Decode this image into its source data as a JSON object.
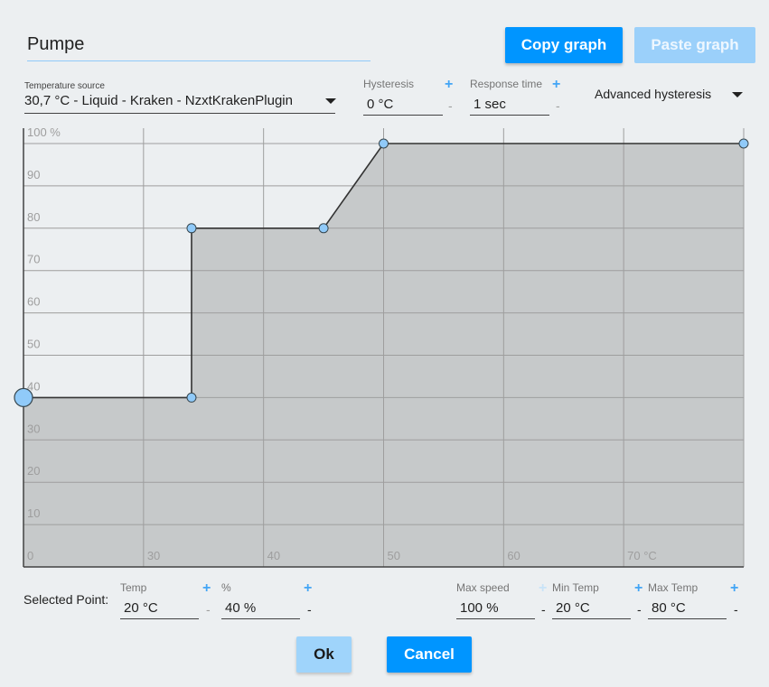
{
  "profile": {
    "name": "Pumpe"
  },
  "header": {
    "copy_label": "Copy graph",
    "paste_label": "Paste graph"
  },
  "source": {
    "label": "Temperature source",
    "value": "30,7 °C - Liquid - Kraken - NzxtKrakenPlugin"
  },
  "hysteresis": {
    "label": "Hysteresis",
    "value": "0 °C",
    "plus": "+",
    "minus": "-"
  },
  "response_time": {
    "label": "Response time",
    "value": "1 sec",
    "plus": "+",
    "minus": "-"
  },
  "advanced": {
    "label": "Advanced hysteresis"
  },
  "chart_data": {
    "type": "area",
    "x": [
      20,
      34,
      45,
      50,
      80
    ],
    "y": [
      40,
      40,
      80,
      80,
      100,
      100
    ],
    "points": [
      {
        "temp": 20,
        "percent": 40
      },
      {
        "temp": 34,
        "percent": 40
      },
      {
        "temp": 34,
        "percent": 80
      },
      {
        "temp": 45,
        "percent": 80
      },
      {
        "temp": 50,
        "percent": 100
      },
      {
        "temp": 80,
        "percent": 100
      }
    ],
    "xlim": [
      20,
      80
    ],
    "ylim": [
      0,
      100
    ],
    "x_ticks": [
      "0",
      "30",
      "40",
      "50",
      "60",
      "70 °C"
    ],
    "y_ticks": [
      "",
      "10",
      "20",
      "30",
      "40",
      "50",
      "60",
      "70",
      "80",
      "90",
      "100 %"
    ],
    "grid": true,
    "selected_index": 0,
    "colors": {
      "fill": "#c6c9ca",
      "line": "#333333",
      "point": "#90caf9",
      "grid": "#9e9e9e"
    }
  },
  "selected_point": {
    "label": "Selected Point:",
    "temp_label": "Temp",
    "temp_value": "20 °C",
    "percent_label": "%",
    "percent_value": "40 %",
    "plus": "+",
    "minus": "-"
  },
  "limits": {
    "max_speed_label": "Max speed",
    "max_speed_value": "100 %",
    "min_temp_label": "Min Temp",
    "min_temp_value": "20 °C",
    "max_temp_label": "Max Temp",
    "max_temp_value": "80 °C",
    "plus": "+",
    "minus": "-"
  },
  "footer": {
    "ok_label": "Ok",
    "cancel_label": "Cancel"
  }
}
